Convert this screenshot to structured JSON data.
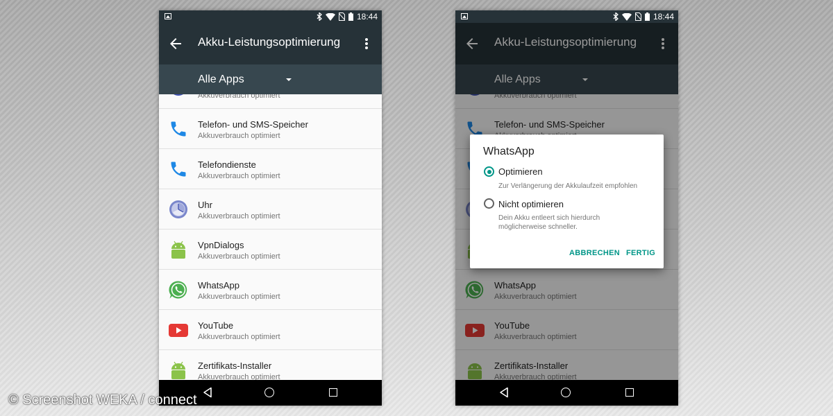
{
  "status_bar": {
    "time": "18:44"
  },
  "app_bar": {
    "title": "Akku-Leistungsoptimierung"
  },
  "filter": {
    "selected": "Alle Apps"
  },
  "list": {
    "partial_subtitle": "Akkuverbrauch optimiert",
    "items": [
      {
        "title": "Telefon- und SMS-Speicher",
        "subtitle": "Akkuverbrauch optimiert",
        "icon": "phone-icon"
      },
      {
        "title": "Telefondienste",
        "subtitle": "Akkuverbrauch optimiert",
        "icon": "phone-icon"
      },
      {
        "title": "Uhr",
        "subtitle": "Akkuverbrauch optimiert",
        "icon": "clock-icon"
      },
      {
        "title": "VpnDialogs",
        "subtitle": "Akkuverbrauch optimiert",
        "icon": "android-icon"
      },
      {
        "title": "WhatsApp",
        "subtitle": "Akkuverbrauch optimiert",
        "icon": "whatsapp-icon"
      },
      {
        "title": "YouTube",
        "subtitle": "Akkuverbrauch optimiert",
        "icon": "youtube-icon"
      },
      {
        "title": "Zertifikats-Installer",
        "subtitle": "Akkuverbrauch optimiert",
        "icon": "android-icon"
      }
    ]
  },
  "dialog": {
    "title": "WhatsApp",
    "options": [
      {
        "label": "Optimieren",
        "description": "Zur Verlängerung der Akkulaufzeit empfohlen",
        "selected": true
      },
      {
        "label": "Nicht optimieren",
        "description": "Dein Akku entleert sich hierdurch möglicherweise schneller.",
        "selected": false
      }
    ],
    "cancel_label": "ABBRECHEN",
    "done_label": "FERTIG"
  },
  "watermark": "© Screenshot WEKA / connect",
  "colors": {
    "app_bar": "#263238",
    "filter_bar": "#37474f",
    "accent": "#009688"
  }
}
